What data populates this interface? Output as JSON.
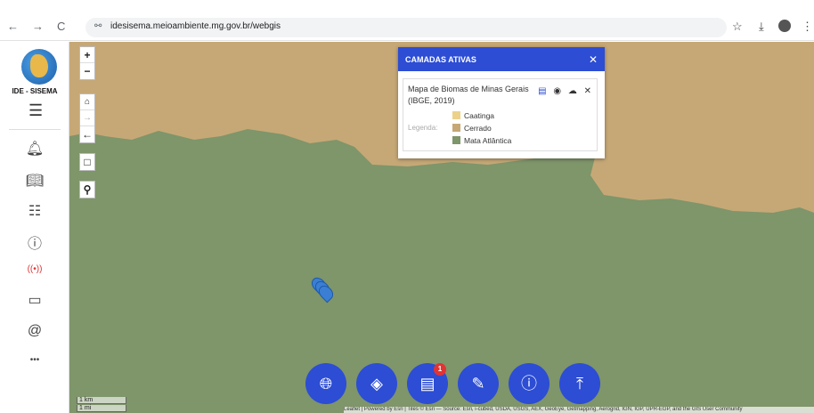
{
  "browser": {
    "url": "idesisema.meioambiente.mg.gov.br/webgis",
    "back": "←",
    "forward": "→",
    "reload": "C",
    "site_icon": "⚯",
    "star": "☆",
    "download": "⤓",
    "menu": "⋮"
  },
  "sidebar": {
    "logo_text": "IDE - SISEMA",
    "menu_icon": "☰",
    "icons": [
      "bell-icon",
      "book-icon",
      "document-icon",
      "info-icon",
      "broadcast-icon",
      "chat-icon",
      "at-icon",
      "more-icon"
    ],
    "glyphs": [
      "🔔︎",
      "📖︎",
      "☷",
      "ⓘ",
      "((•))",
      "▭",
      "@",
      "•••"
    ]
  },
  "map_controls": {
    "zoom_in": "+",
    "zoom_out": "−",
    "home": "⌂",
    "forward": "→",
    "back": "←",
    "select": "□",
    "search": "⚲"
  },
  "panel": {
    "title": "CAMADAS ATIVAS",
    "close": "✕",
    "layer_name": "Mapa de Biomas de Minas Gerais (IBGE, 2019)",
    "tools": [
      "▤",
      "◉",
      "☁",
      "✕"
    ],
    "legend_label": "Legenda:",
    "legend": [
      {
        "label": "Caatinga",
        "color": "#ecd18a"
      },
      {
        "label": "Cerrado",
        "color": "#c6a876"
      },
      {
        "label": "Mata Atlântica",
        "color": "#7f956a"
      }
    ]
  },
  "fabs": {
    "globe": "🌐︎",
    "layers": "◈",
    "list": "▤",
    "edit": "✎",
    "alert": "ⓘ",
    "top": "⤒"
  },
  "badge": "1",
  "scale": {
    "km": "1 km",
    "mi": "1 mi"
  },
  "attribution": "Leaflet | Powered by Esri | Tiles © Esri — Source: Esri, i-cubed, USDA, USGS, AEX, GeoEye, Getmapping, Aerogrid, IGN, IGP, UPR-EGP, and the GIS User Community",
  "colors": {
    "accent": "#2c4dd4",
    "mata_atlantica": "#7f956a",
    "cerrado": "#c6a876"
  }
}
